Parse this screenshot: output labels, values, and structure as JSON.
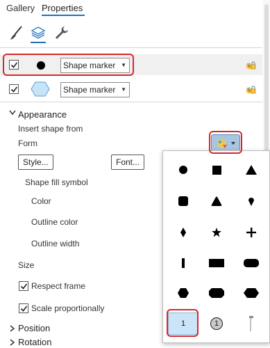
{
  "tabs": [
    {
      "label": "Gallery"
    },
    {
      "label": "Properties"
    }
  ],
  "tool_icons": [
    "paintbrush-icon",
    "layers-icon",
    "wrench-icon"
  ],
  "symbol_layers": [
    {
      "checked": true,
      "preview": "circle-marker-preview",
      "marker_type": "Shape marker"
    },
    {
      "checked": true,
      "preview": "hexagon-marker-preview",
      "marker_type": "Shape marker"
    }
  ],
  "appearance": {
    "header": "Appearance",
    "insert_shape_from": "Insert shape from",
    "form_label": "Form",
    "style_button": "Style...",
    "font_button": "Font...",
    "shape_fill_symbol": "Shape fill symbol",
    "color_label": "Color",
    "outline_color_label": "Outline color",
    "outline_width_label": "Outline width",
    "size_label": "Size",
    "respect_frame": {
      "label": "Respect frame",
      "checked": true
    },
    "scale_proportionally": {
      "label": "Scale proportionally",
      "checked": true
    }
  },
  "collapsed_sections": [
    "Position",
    "Rotation"
  ],
  "shape_gallery": {
    "items": [
      "circle",
      "square",
      "triangle",
      "rounded-square",
      "rounded-triangle",
      "pin",
      "diamond",
      "star",
      "cross",
      "vertical-bar",
      "horizontal-rectangle",
      "rounded-rectangle",
      "hexagon",
      "octagon",
      "wide-hexagon",
      "numbered-box",
      "numbered-circle",
      "callout-line"
    ],
    "numbered_box_text": "1",
    "numbered_circle_text": "1",
    "selected": "numbered-box"
  },
  "colors": {
    "accent": "#1f6fbf",
    "highlight": "#d9262b",
    "selected_cell": "#cce4f7",
    "hexagon_fill": "#c7e3f7"
  }
}
